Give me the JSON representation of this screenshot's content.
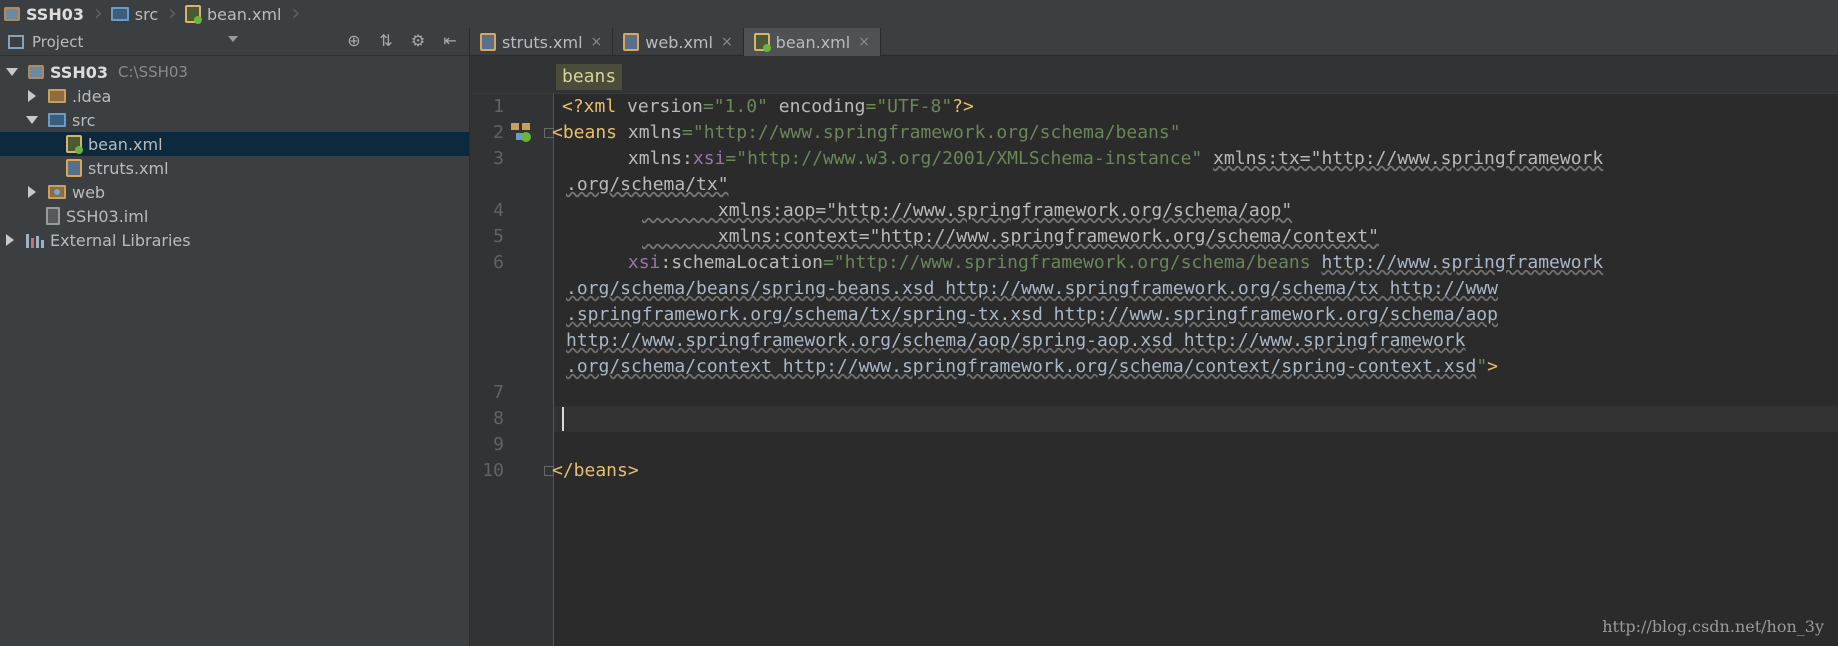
{
  "breadcrumb": [
    {
      "label": "SSH03",
      "icon": "module-icon"
    },
    {
      "label": "src",
      "icon": "folder-icon"
    },
    {
      "label": "bean.xml",
      "icon": "spring-xml-icon"
    }
  ],
  "project_panel": {
    "title": "Project",
    "tree": [
      {
        "label": "SSH03",
        "path": "C:\\SSH03",
        "icon": "module-icon",
        "expanded": true
      },
      {
        "label": ".idea",
        "icon": "folder-icon",
        "expanded": false
      },
      {
        "label": "src",
        "icon": "source-folder-icon",
        "expanded": true
      },
      {
        "label": "bean.xml",
        "icon": "spring-xml-icon",
        "selected": true
      },
      {
        "label": "struts.xml",
        "icon": "xml-icon"
      },
      {
        "label": "web",
        "icon": "web-folder-icon",
        "expanded": false
      },
      {
        "label": "SSH03.iml",
        "icon": "iml-file-icon"
      },
      {
        "label": "External Libraries",
        "icon": "library-icon",
        "expanded": false
      }
    ]
  },
  "tabs": [
    {
      "label": "struts.xml",
      "icon": "xml-icon",
      "close": "×"
    },
    {
      "label": "web.xml",
      "icon": "xml-icon",
      "close": "×"
    },
    {
      "label": "bean.xml",
      "icon": "spring-xml-icon",
      "close": "×",
      "active": true
    }
  ],
  "tag_breadcrumb": "beans",
  "line_numbers": [
    "1",
    "2",
    "3",
    "4",
    "5",
    "6",
    "7",
    "8",
    "9",
    "10"
  ],
  "code": {
    "l1": {
      "a": "<?xml ",
      "b": "version",
      "c": "=",
      "d": "\"1.0\"",
      "e": " encoding",
      "f": "=",
      "g": "\"UTF-8\"",
      "h": "?>"
    },
    "l2": {
      "a": "<beans ",
      "b": "xmlns",
      "c": "=",
      "d": "\"http://www.springframework.org/schema/beans\""
    },
    "l3": {
      "a": "       xmlns:",
      "b": "xsi",
      "c": "=",
      "d": "\"http://www.w3.org/2001/XMLSchema-instance\"",
      "e": " ",
      "f": "xmlns:tx=\"http://www.springframework"
    },
    "l3b": ".org/schema/tx\"",
    "l4": "       xmlns:aop=\"http://www.springframework.org/schema/aop\"",
    "l5": "       xmlns:context=\"http://www.springframework.org/schema/context\"",
    "l6": {
      "a": "       ",
      "b": "xsi",
      "c": ":schemaLocation",
      "d": "=",
      "e": "\"http://www.springframework.org/schema/beans ",
      "f": "http://www.springframework"
    },
    "l6b": ".org/schema/beans/spring-beans.xsd http://www.springframework.org/schema/tx http://www",
    "l6c": ".springframework.org/schema/tx/spring-tx.xsd http://www.springframework.org/schema/aop",
    "l6d": "http://www.springframework.org/schema/aop/spring-aop.xsd http://www.springframework",
    "l6e": {
      "a": ".org/schema/context http://www.springframework.org/schema/context/spring-context.xsd",
      "b": "\"",
      "c": ">"
    },
    "l10": "</beans>"
  },
  "watermark": "http://blog.csdn.net/hon_3y",
  "colors": {
    "background": "#2b2b2b",
    "panel": "#3c3f41",
    "selection": "#0d293e",
    "tag": "#e8bf6a",
    "string": "#6a8759",
    "namespace": "#9876aa"
  }
}
